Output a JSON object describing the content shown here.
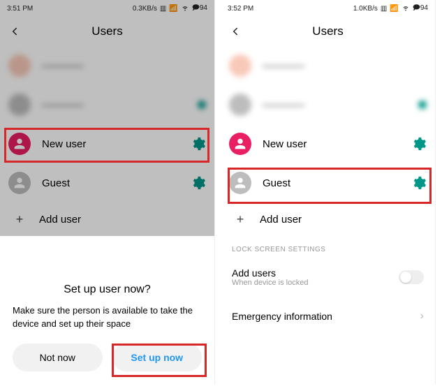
{
  "left": {
    "status": {
      "time": "3:51 PM",
      "net": "0.3KB/s",
      "batt": "94"
    },
    "title": "Users",
    "rows": {
      "new_user": "New user",
      "guest": "Guest",
      "add_user": "Add user"
    },
    "sheet": {
      "title": "Set up user now?",
      "body": "Make sure the person is available to take the device and set up their space",
      "not_now": "Not now",
      "setup": "Set up now"
    }
  },
  "right": {
    "status": {
      "time": "3:52 PM",
      "net": "1.0KB/s",
      "batt": "94"
    },
    "title": "Users",
    "rows": {
      "new_user": "New user",
      "guest": "Guest",
      "add_user": "Add user"
    },
    "section": "LOCK SCREEN SETTINGS",
    "add_users_title": "Add users",
    "add_users_sub": "When device is locked",
    "emergency": "Emergency information"
  }
}
